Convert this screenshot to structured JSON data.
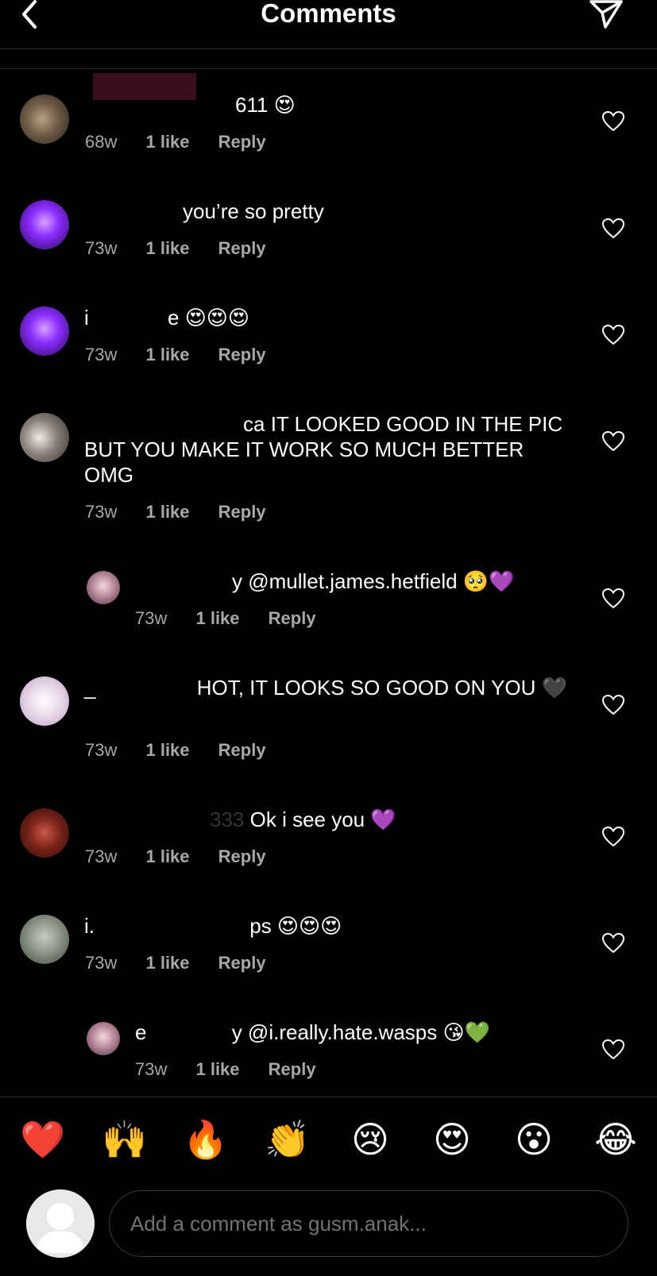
{
  "header": {
    "title": "Comments",
    "back_icon": "chevron-left-icon",
    "share_icon": "send-icon"
  },
  "comments": [
    {
      "username": "",
      "text": "611 😍",
      "age": "68w",
      "likes": "1 like",
      "reply": "Reply"
    },
    {
      "username": "",
      "text": "you’re so pretty",
      "age": "73w",
      "likes": "1 like",
      "reply": "Reply"
    },
    {
      "username": "i",
      "text": "e 😍😍😍",
      "age": "73w",
      "likes": "1 like",
      "reply": "Reply"
    },
    {
      "username": "ca",
      "text": "IT LOOKED GOOD IN THE PIC BUT YOU MAKE IT WORK SO MUCH BETTER OMG",
      "age": "73w",
      "likes": "1 like",
      "reply": "Reply"
    },
    {
      "username": "y",
      "text": "@mullet.james.hetfield 🥺💜",
      "age": "73w",
      "likes": "1 like",
      "reply": "Reply"
    },
    {
      "username": "_",
      "text": "HOT, IT LOOKS SO GOOD ON YOU 🖤",
      "age": "73w",
      "likes": "1 like",
      "reply": "Reply"
    },
    {
      "username": "333",
      "text": "Ok i see you 💜",
      "age": "73w",
      "likes": "1 like",
      "reply": "Reply"
    },
    {
      "username": "i.",
      "text": "ps 😍😍😍",
      "age": "73w",
      "likes": "1 like",
      "reply": "Reply"
    },
    {
      "username": "e",
      "text": "y @i.really.hate.wasps 😘💚",
      "age": "73w",
      "likes": "1 like",
      "reply": "Reply"
    }
  ],
  "emoji_bar": [
    "❤️",
    "🙌",
    "🔥",
    "👏",
    "😢",
    "😍",
    "😮",
    "😂"
  ],
  "composer": {
    "placeholder": "Add a comment as gusm.anak..."
  },
  "colors": {
    "background": "#000000",
    "meta_text": "#a8a8a8",
    "divider": "#262626"
  }
}
